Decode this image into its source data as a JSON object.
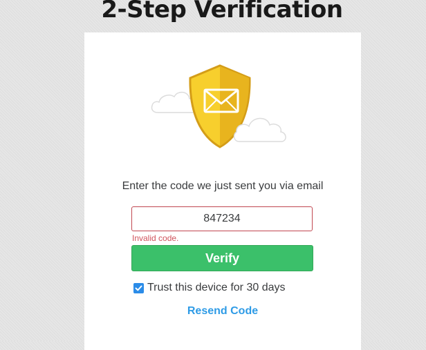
{
  "page": {
    "title": "2-Step Verification"
  },
  "illustration": {
    "icon": "shield-envelope-icon",
    "colors": {
      "shield_light": "#f7cf2d",
      "shield_dark": "#e8b41e",
      "shield_outline": "#d49d18",
      "envelope": "#ffffff"
    }
  },
  "form": {
    "prompt": "Enter the code we just sent you via email",
    "code_value": "847234",
    "error_message": "Invalid code.",
    "verify_label": "Verify",
    "trust_device_label": "Trust this device for 30 days",
    "trust_device_checked": true,
    "resend_label": "Resend Code"
  },
  "colors": {
    "verify_button": "#3bc06a",
    "link": "#2e9be6",
    "error": "#d0535c",
    "checkbox": "#2b8ce8"
  }
}
